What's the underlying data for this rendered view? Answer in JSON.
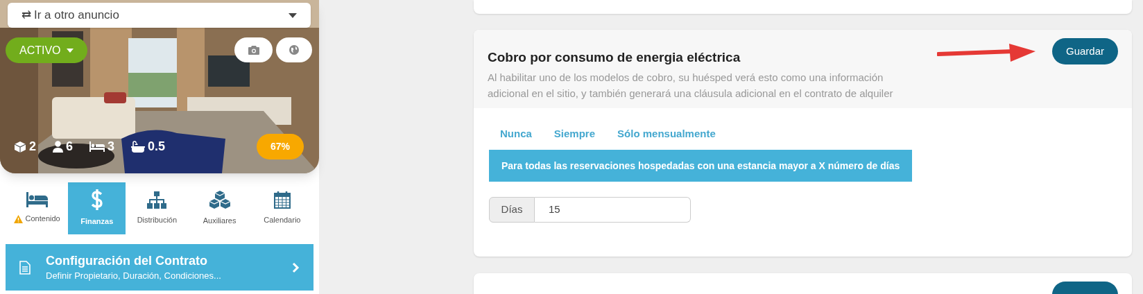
{
  "listing_selector": {
    "icon": "⇄",
    "value": "Ir a otro anuncio"
  },
  "listing": {
    "status": "ACTIVO",
    "progress": "67%",
    "stats": [
      {
        "kind": "cube",
        "value": "2"
      },
      {
        "kind": "person",
        "value": "6"
      },
      {
        "kind": "bed",
        "value": "3"
      },
      {
        "kind": "bath",
        "value": "0.5"
      }
    ]
  },
  "sections": [
    {
      "kind": "bed",
      "label": "Contenido",
      "selected": false,
      "warning": true
    },
    {
      "kind": "dollar",
      "label": "Finanzas",
      "selected": true,
      "warning": false
    },
    {
      "kind": "sitemap",
      "label": "Distribución",
      "selected": false,
      "warning": false
    },
    {
      "kind": "cubes",
      "label": "Auxiliares",
      "selected": false,
      "warning": false
    },
    {
      "kind": "calendar",
      "label": "Calendario",
      "selected": false,
      "warning": false
    }
  ],
  "contract_link": {
    "title": "Configuración del Contrato",
    "subtitle": "Definir Propietario, Duración, Condiciones..."
  },
  "energy_card": {
    "title": "Cobro por consumo de energia eléctrica",
    "description": "Al habilitar uno de los modelos de cobro, su huésped verá esto como una información adicional en el sitio, y también generará una cláusula adicional en el contrato de alquiler",
    "button": "Guardar",
    "options": [
      {
        "label": "Nunca",
        "selected": false
      },
      {
        "label": "Siempre",
        "selected": false
      },
      {
        "label": "Sólo mensualmente",
        "selected": false
      },
      {
        "label": "Para todas las reservaciones hospedadas con una estancia mayor a X número de días",
        "selected": true
      }
    ],
    "field": {
      "label": "Días",
      "value": "15"
    }
  }
}
